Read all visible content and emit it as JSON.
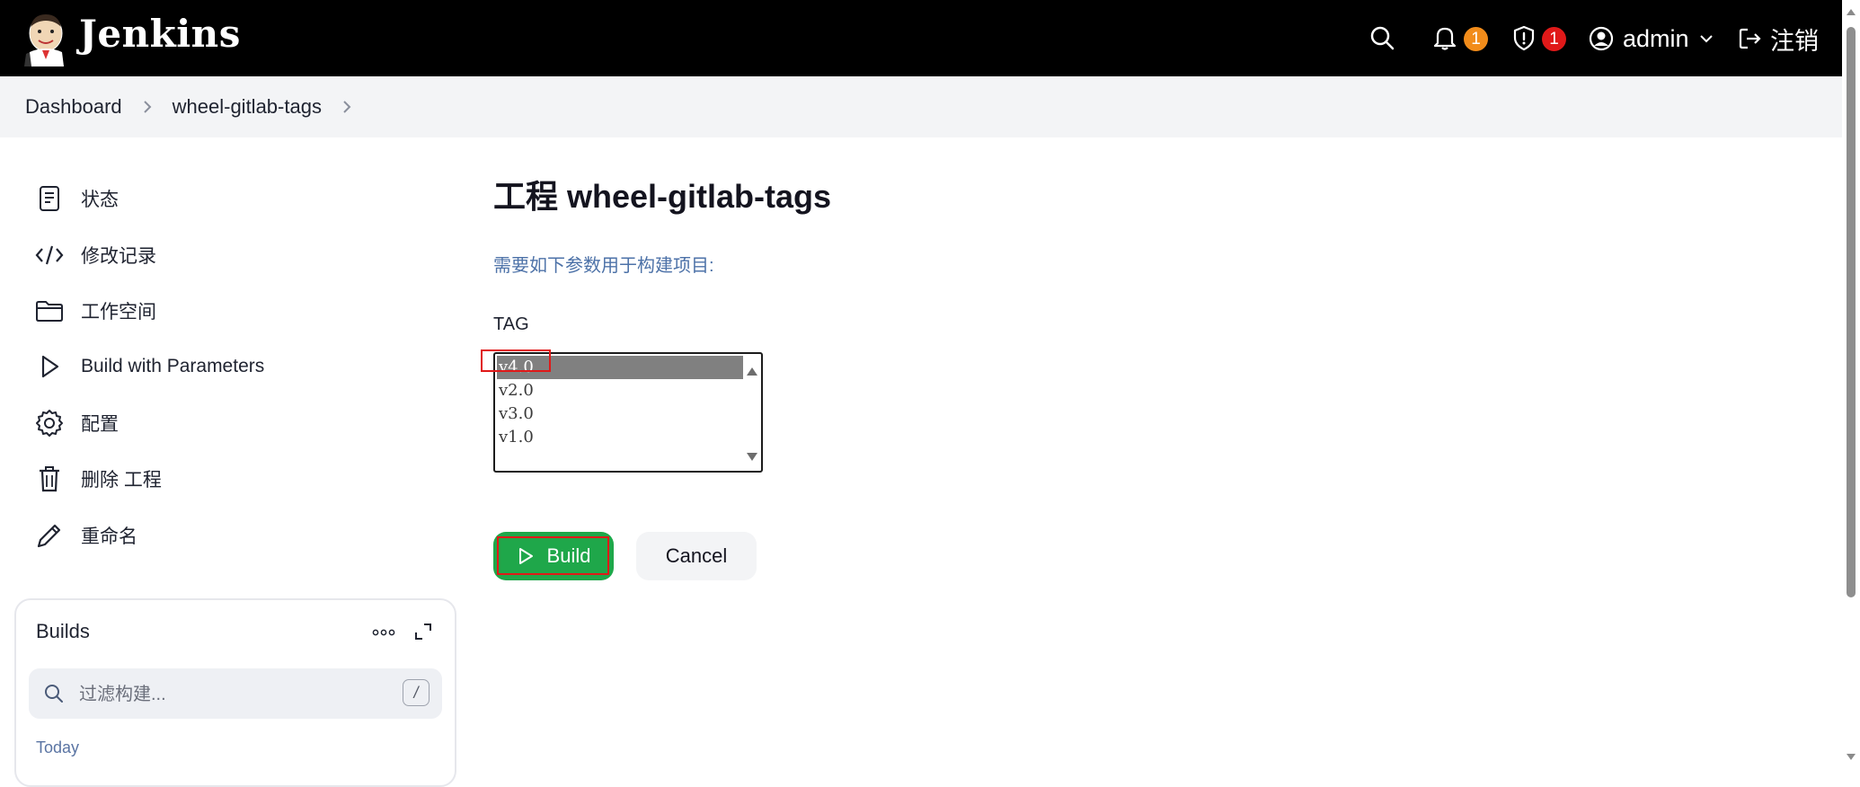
{
  "header": {
    "brand": "Jenkins",
    "notifications_count": "1",
    "security_count": "1",
    "user": "admin",
    "logout": "注销",
    "colors": {
      "background": "#000000",
      "notification_badge": "#f28c1a",
      "security_badge": "#e01919"
    }
  },
  "breadcrumb": {
    "items": [
      "Dashboard",
      "wheel-gitlab-tags"
    ]
  },
  "sidebar": {
    "items": [
      {
        "label": "状态",
        "icon": "document-icon"
      },
      {
        "label": "修改记录",
        "icon": "code-icon"
      },
      {
        "label": "工作空间",
        "icon": "folder-icon"
      },
      {
        "label": "Build with Parameters",
        "icon": "play-icon"
      },
      {
        "label": "配置",
        "icon": "gear-icon"
      },
      {
        "label": "删除 工程",
        "icon": "trash-icon"
      },
      {
        "label": "重命名",
        "icon": "pencil-icon"
      }
    ]
  },
  "builds": {
    "title": "Builds",
    "filter_placeholder": "过滤构建...",
    "shortcut": "/",
    "today": "Today"
  },
  "main": {
    "title": "工程 wheel-gitlab-tags",
    "description": "需要如下参数用于构建项目:",
    "param_label": "TAG",
    "options": [
      "v4.0",
      "v2.0",
      "v3.0",
      "v1.0"
    ],
    "selected": "v4.0",
    "build_button": "Build",
    "cancel_button": "Cancel",
    "colors": {
      "build_button": "#1fa74a",
      "description": "#4d72a8",
      "highlight": "#e01919"
    }
  }
}
